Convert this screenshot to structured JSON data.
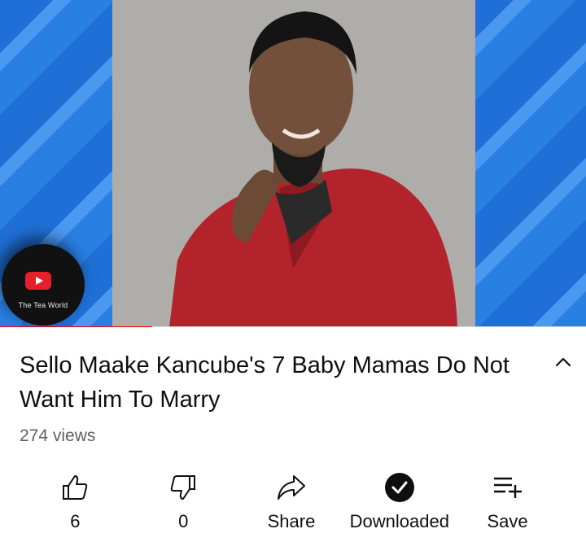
{
  "video": {
    "channel_logo_text": "The Tea World",
    "progress_fraction": 0.26
  },
  "title": "Sello Maake Kancube's 7 Baby Mamas Do Not Want Him To Marry",
  "views": "274 views",
  "actions": [
    {
      "icon": "thumbs-up-icon",
      "label": "6"
    },
    {
      "icon": "thumbs-down-icon",
      "label": "0"
    },
    {
      "icon": "share-icon",
      "label": "Share"
    },
    {
      "icon": "downloaded-check-icon",
      "label": "Downloaded"
    },
    {
      "icon": "add-to-playlist-icon",
      "label": "Save"
    }
  ],
  "colors": {
    "progress": "#ff0000",
    "text": "#0f0f0f",
    "secondary_text": "#606060"
  }
}
